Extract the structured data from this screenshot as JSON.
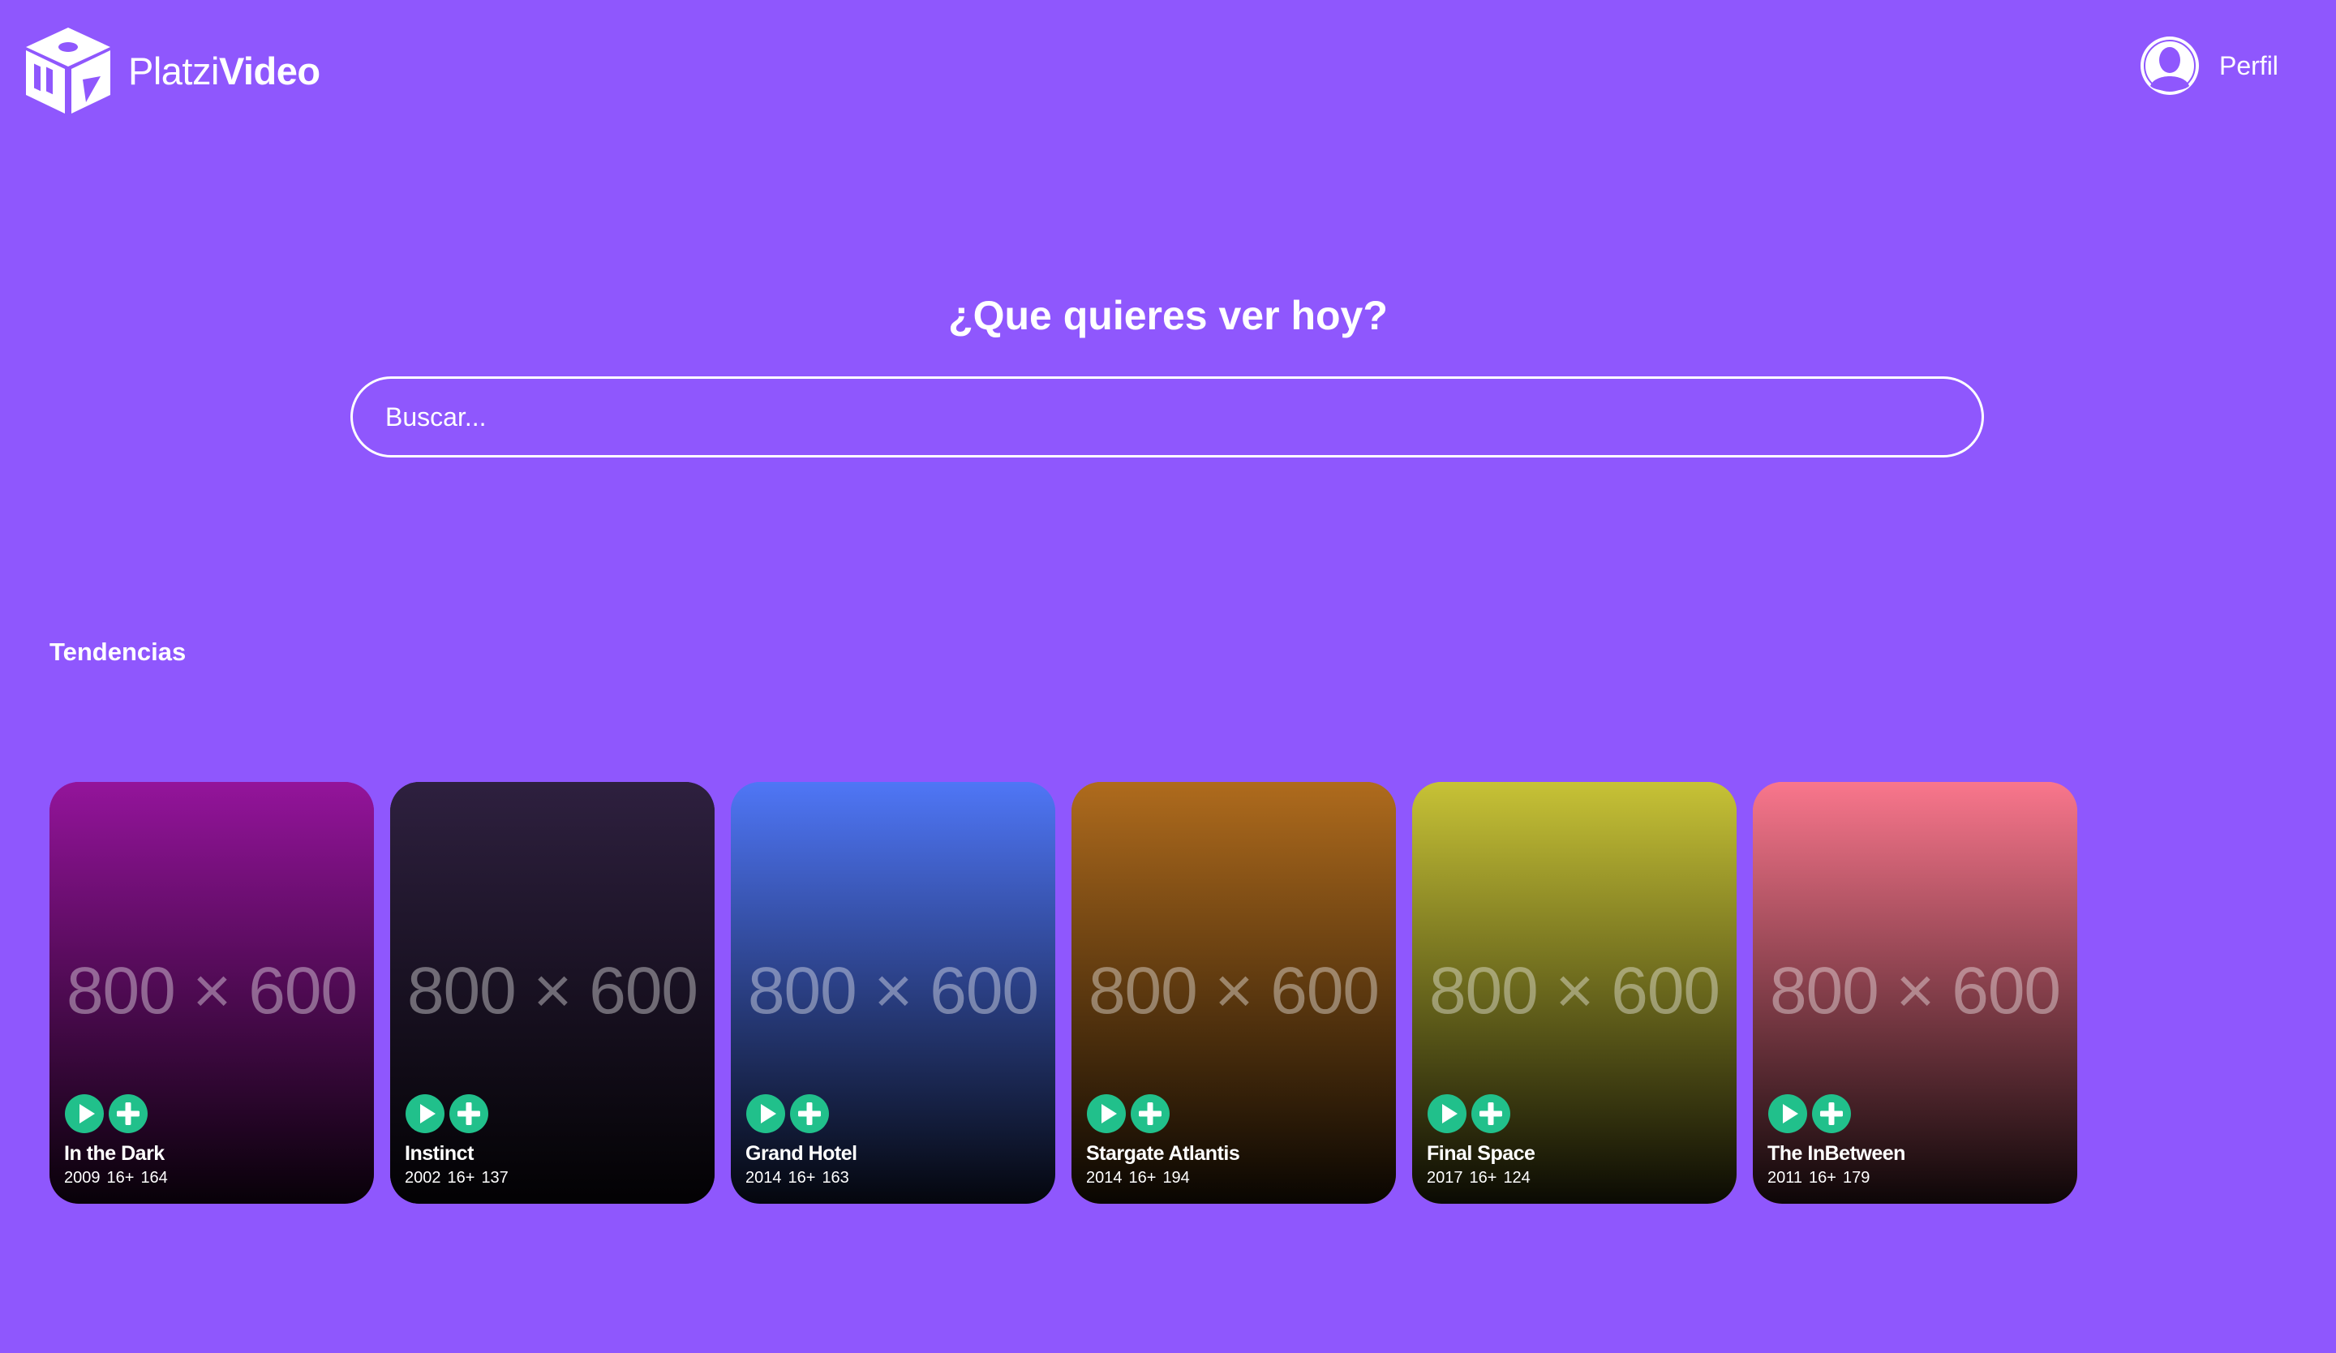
{
  "header": {
    "logo_text_light": "Platzi",
    "logo_text_bold": "Video",
    "profile_label": "Perfil",
    "logo_icon": "platzi-video-cube-logo",
    "profile_icon": "user-avatar-icon"
  },
  "hero": {
    "title": "¿Que quieres ver hoy?",
    "search_placeholder": "Buscar..."
  },
  "trending": {
    "title": "Tendencias",
    "placeholder_text": "800 × 600",
    "icons": [
      "play-icon",
      "plus-icon"
    ],
    "items": [
      {
        "title": "In the Dark",
        "year": "2009",
        "rating": "16+",
        "duration": "164",
        "color": "#94149b"
      },
      {
        "title": "Instinct",
        "year": "2002",
        "rating": "16+",
        "duration": "137",
        "color": "#2e203f"
      },
      {
        "title": "Grand Hotel",
        "year": "2014",
        "rating": "16+",
        "duration": "163",
        "color": "#4f76f6"
      },
      {
        "title": "Stargate Atlantis",
        "year": "2014",
        "rating": "16+",
        "duration": "194",
        "color": "#af6b1d"
      },
      {
        "title": "Final Space",
        "year": "2017",
        "rating": "16+",
        "duration": "124",
        "color": "#c7c236"
      },
      {
        "title": "The InBetween",
        "year": "2011",
        "rating": "16+",
        "duration": "179",
        "color": "#f9768c"
      }
    ]
  },
  "colors": {
    "background": "#8f57fd",
    "accent": "#21c08b",
    "text": "#ffffff"
  }
}
